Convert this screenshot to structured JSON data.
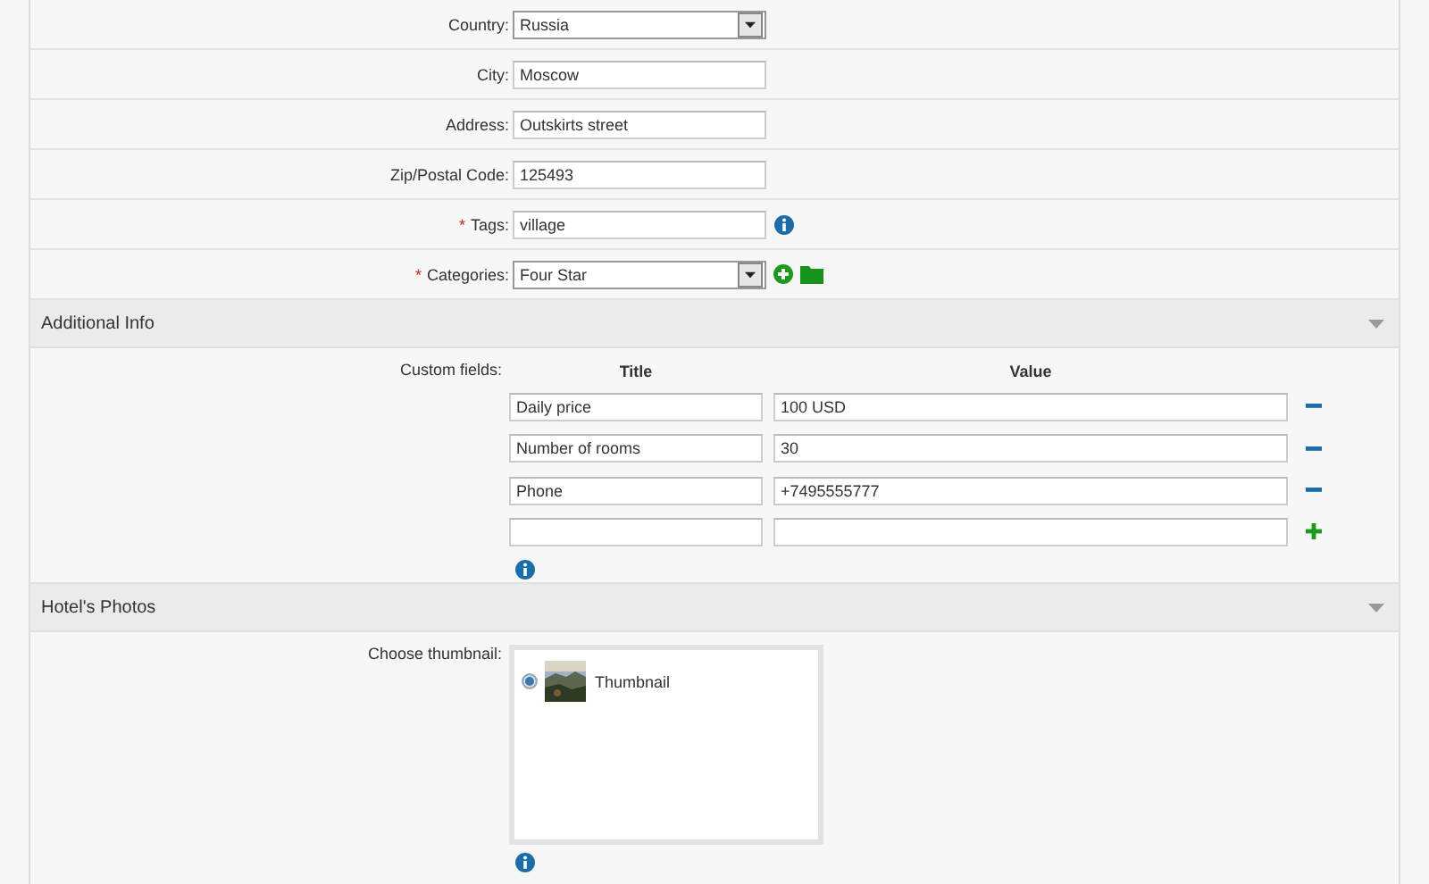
{
  "location_fields": [
    {
      "label": "Country:",
      "kind": "select",
      "value": "Russia",
      "required": false
    },
    {
      "label": "City:",
      "kind": "text",
      "value": "Moscow",
      "required": false
    },
    {
      "label": "Address:",
      "kind": "text",
      "value": "Outskirts street",
      "required": false
    },
    {
      "label": "Zip/Postal Code:",
      "kind": "text",
      "value": "125493",
      "required": false
    },
    {
      "label": "Tags:",
      "kind": "text",
      "value": "village",
      "required": true,
      "addons": [
        {
          "kind": "info"
        }
      ]
    },
    {
      "label": "Categories:",
      "kind": "select",
      "value": "Four Star",
      "required": true,
      "addons": [
        {
          "kind": "add"
        },
        {
          "kind": "folder"
        }
      ]
    }
  ],
  "required_mark": "*",
  "additional_info": {
    "title": "Additional Info",
    "expanded": true,
    "label": "Custom fields:",
    "columns": [
      "Title",
      "Value"
    ],
    "rows": [
      {
        "title": "Daily price",
        "value": "100 USD",
        "kind": "remove"
      },
      {
        "title": "Number of rooms",
        "value": "30",
        "kind": "remove"
      },
      {
        "title": "Phone",
        "value": "+7495555777",
        "kind": "remove"
      },
      {
        "kind": "add"
      }
    ]
  },
  "photos": {
    "title": "Hotel's Photos",
    "expanded": true,
    "label": "Choose thumbnail:",
    "thumbnails": [
      {
        "caption": "Thumbnail",
        "selected": true,
        "kind": "picture"
      }
    ]
  }
}
